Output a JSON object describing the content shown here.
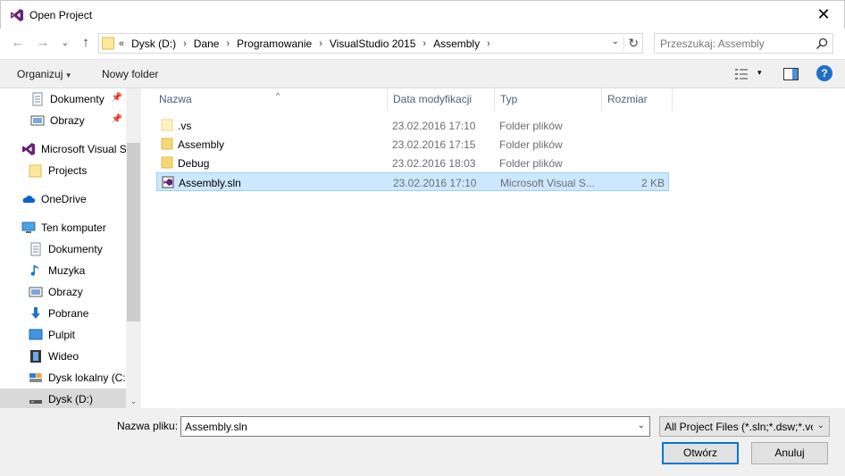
{
  "window": {
    "title": "Open Project",
    "close_glyph": "✕"
  },
  "nav": {
    "back_glyph": "←",
    "forward_glyph": "→",
    "recent_glyph": "⌄",
    "up_glyph": "↑",
    "breadcrumb_lead": "«",
    "breadcrumbs": [
      "Dysk (D:)",
      "Dane",
      "Programowanie",
      "VisualStudio 2015",
      "Assembly"
    ],
    "crumb_separator": "›",
    "dropdown_glyph": "⌄",
    "refresh_glyph": "↻",
    "search_placeholder": "Przeszukaj: Assembly"
  },
  "toolbar": {
    "organize_label": "Organizuj",
    "new_folder_label": "Nowy folder",
    "caret": "▾",
    "help_label": "?"
  },
  "sidebar": {
    "items": [
      {
        "label": "Dokumenty",
        "icon": "documents-icon",
        "pinned": true,
        "pin_glyph": "📌"
      },
      {
        "label": "Obrazy",
        "icon": "pictures-icon",
        "pinned": true,
        "pin_glyph": "📌"
      },
      {
        "label": "Microsoft Visual S",
        "icon": "visual-studio-icon"
      },
      {
        "label": "Projects",
        "icon": "folder-icon"
      },
      {
        "label": "OneDrive",
        "icon": "onedrive-icon"
      },
      {
        "label": "Ten komputer",
        "icon": "computer-icon"
      },
      {
        "label": "Dokumenty",
        "icon": "documents-icon"
      },
      {
        "label": "Muzyka",
        "icon": "music-icon"
      },
      {
        "label": "Obrazy",
        "icon": "pictures-icon"
      },
      {
        "label": "Pobrane",
        "icon": "downloads-icon"
      },
      {
        "label": "Pulpit",
        "icon": "desktop-icon"
      },
      {
        "label": "Wideo",
        "icon": "video-icon"
      },
      {
        "label": "Dysk lokalny (C:)",
        "icon": "drive-icon"
      },
      {
        "label": "Dysk (D:)",
        "icon": "drive-icon",
        "selected": true
      }
    ],
    "scroll_down_glyph": "⌄"
  },
  "filelist": {
    "columns": [
      "Nazwa",
      "Data modyfikacji",
      "Typ",
      "Rozmiar"
    ],
    "sort_glyph": "^",
    "rows": [
      {
        "name": ".vs",
        "date": "23.02.2016 17:10",
        "type": "Folder plików",
        "size": "",
        "icon": "folder-icon"
      },
      {
        "name": "Assembly",
        "date": "23.02.2016 17:15",
        "type": "Folder plików",
        "size": "",
        "icon": "folder-icon"
      },
      {
        "name": "Debug",
        "date": "23.02.2016 18:03",
        "type": "Folder plików",
        "size": "",
        "icon": "folder-icon"
      },
      {
        "name": "Assembly.sln",
        "date": "23.02.2016 17:10",
        "type": "Microsoft Visual S...",
        "size": "2 KB",
        "icon": "solution-file-icon",
        "selected": true
      }
    ]
  },
  "bottom": {
    "filename_label": "Nazwa pliku:",
    "filename_value": "Assembly.sln",
    "filter_value": "All Project Files (*.sln;*.dsw;*.vc",
    "open_label": "Otwórz",
    "cancel_label": "Anuluj",
    "dropdown_glyph": "⌄"
  },
  "colors": {
    "accent": "#0078d7",
    "selection": "#cce8ff",
    "vs_purple": "#68217a",
    "folder": "#f8d775"
  }
}
